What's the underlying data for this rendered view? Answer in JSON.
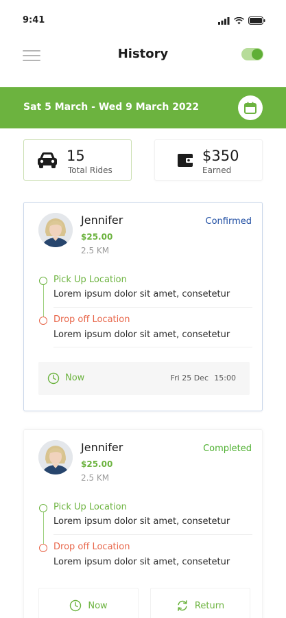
{
  "status_bar": {
    "time": "9:41"
  },
  "header": {
    "title": "History"
  },
  "banner": {
    "date_range": "Sat 5 March - Wed 9 March 2022"
  },
  "stats": {
    "rides": {
      "value": "15",
      "label": "Total Rides",
      "icon": "car-icon"
    },
    "earned": {
      "value": "$350",
      "label": "Earned",
      "icon": "wallet-icon"
    }
  },
  "rides": [
    {
      "name": "Jennifer",
      "fare": "$25.00",
      "distance": "2.5 KM",
      "status": "Confirmed",
      "pickup_label": "Pick Up Location",
      "pickup_address": "Lorem ipsum dolor sit amet, consetetur",
      "drop_label": "Drop off Location",
      "drop_address": "Lorem ipsum dolor sit amet, consetetur",
      "time_label": "Now",
      "date": "Fri 25 Dec",
      "time": "15:00"
    },
    {
      "name": "Jennifer",
      "fare": "$25.00",
      "distance": "2.5 KM",
      "status": "Completed",
      "pickup_label": "Pick Up Location",
      "pickup_address": "Lorem ipsum dolor sit amet, consetetur",
      "drop_label": "Drop off Location",
      "drop_address": "Lorem ipsum dolor sit amet, consetetur",
      "now_button": "Now",
      "return_button": "Return"
    }
  ],
  "colors": {
    "accent_green": "#6cb33f",
    "drop_red": "#e8674b",
    "confirmed_blue": "#1f4ea3"
  }
}
